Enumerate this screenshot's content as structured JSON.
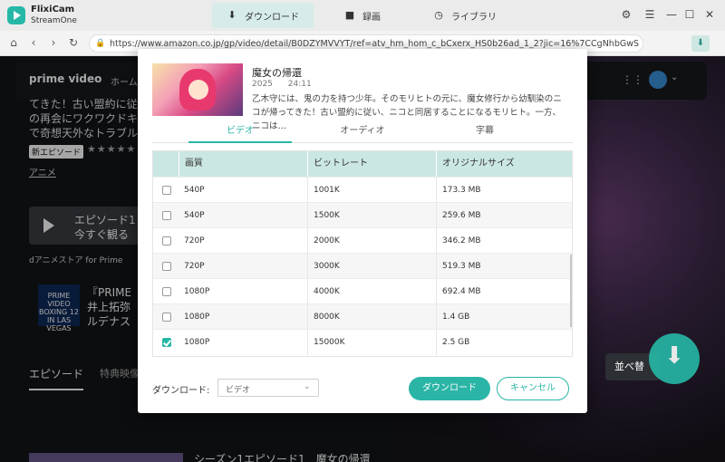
{
  "app": {
    "name": "FlixiCam",
    "subtitle": "StreamOne",
    "nav": {
      "download": "ダウンロード",
      "record": "録画",
      "library": "ライブラリ"
    },
    "icons": {
      "settings": "⚙",
      "menu": "☰",
      "minimize": "—",
      "maximize": "☐",
      "close": "✕"
    }
  },
  "browser": {
    "url": "https://www.amazon.co.jp/gp/video/detail/B0DZYMVVYT/ref=atv_hm_hom_c_bCxerx_HS0b26ad_1_2?jic=16%7CCgNhbGwSA2Fs"
  },
  "background_page": {
    "logo": "prime video",
    "nav_home": "ホーム",
    "desc_line1": "てきた！古い盟約に従い",
    "desc_line2": "の再会にワクワクドキ",
    "desc_line3": "で奇想天外なトラブル",
    "badge": "新エピソード",
    "stars": "★★★★★",
    "genre": "アニメ",
    "play_line1": "エピソード1",
    "play_line2": "今すぐ観る",
    "channel": "dアニメストア for Prime",
    "boxing_logo": "PRIME VIDEO BOXING 12 IN LAS VEGAS",
    "boxing_line1": "『PRIME",
    "boxing_line2": "井上拓弥",
    "boxing_line3": "ルデナス",
    "tab_episodes": "エピソード",
    "tab_extras": "特典映像",
    "sort_label": "並べ替",
    "bottom_title": "シーズン1エピソード1　魔女の帰還"
  },
  "modal": {
    "title": "魔女の帰還",
    "year": "2025",
    "duration": "24:11",
    "description": "乙木守には、鬼の力を持つ少年。そのモリヒトの元に、魔女修行から幼馴染のニコが帰ってきた！古い盟約に従い、ニコと同居することになるモリヒト。一方、ニコは…",
    "tabs": [
      {
        "label": "ビデオ",
        "active": true
      },
      {
        "label": "オーディオ",
        "active": false
      },
      {
        "label": "字幕",
        "active": false
      }
    ],
    "table": {
      "headers": [
        "画質",
        "ビットレート",
        "オリジナルサイズ"
      ],
      "rows": [
        {
          "quality": "540P",
          "bitrate": "1001K",
          "size": "173.3 MB",
          "checked": false
        },
        {
          "quality": "540P",
          "bitrate": "1500K",
          "size": "259.6 MB",
          "checked": false
        },
        {
          "quality": "720P",
          "bitrate": "2000K",
          "size": "346.2 MB",
          "checked": false
        },
        {
          "quality": "720P",
          "bitrate": "3000K",
          "size": "519.3 MB",
          "checked": false
        },
        {
          "quality": "1080P",
          "bitrate": "4000K",
          "size": "692.4 MB",
          "checked": false
        },
        {
          "quality": "1080P",
          "bitrate": "8000K",
          "size": "1.4 GB",
          "checked": false
        },
        {
          "quality": "1080P",
          "bitrate": "15000K",
          "size": "2.5 GB",
          "checked": true
        }
      ]
    },
    "download_label": "ダウンロード:",
    "download_select": "ビデオ",
    "download_button": "ダウンロード",
    "cancel_button": "キャンセル"
  }
}
